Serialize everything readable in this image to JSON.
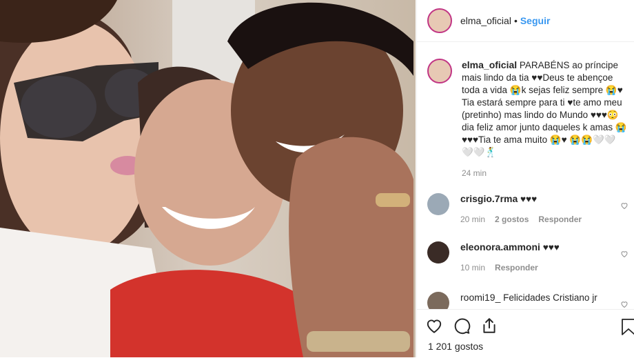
{
  "post": {
    "username": "elma_oficial",
    "follow_label": "Seguir",
    "separator": "•"
  },
  "caption": {
    "username": "elma_oficial",
    "text": "PARABÉNS ao príncipe mais lindo da tia ♥♥Deus te abençoe toda a vida 😭k sejas feliz sempre 😭♥ Tia estará sempre para ti ♥te amo meu (pretinho) mas lindo do Mundo ♥♥♥😳dia feliz amor junto daqueles k amas 😭♥♥♥Tia te ama muito 😭♥ 😭😭🤍🤍🤍🤍🕺",
    "time": "24 min"
  },
  "comments": [
    {
      "username": "crisgio.7rma",
      "text": "♥♥♥",
      "time": "20 min",
      "likes": "2 gostos",
      "reply": "Responder"
    },
    {
      "username": "eleonora.ammoni",
      "text": "♥♥♥",
      "time": "10 min",
      "likes": "",
      "reply": "Responder"
    },
    {
      "username": "roomi19_",
      "text": "Felicidades Cristiano jr",
      "time": "",
      "likes": "",
      "reply": ""
    }
  ],
  "actions": {
    "icons": [
      "heart-icon",
      "comment-icon",
      "share-icon",
      "bookmark-icon"
    ],
    "likes_count": "1 201 gostos"
  },
  "colors": {
    "link": "#3897f0",
    "muted": "#8e8e8e",
    "ring": "#c13584"
  }
}
